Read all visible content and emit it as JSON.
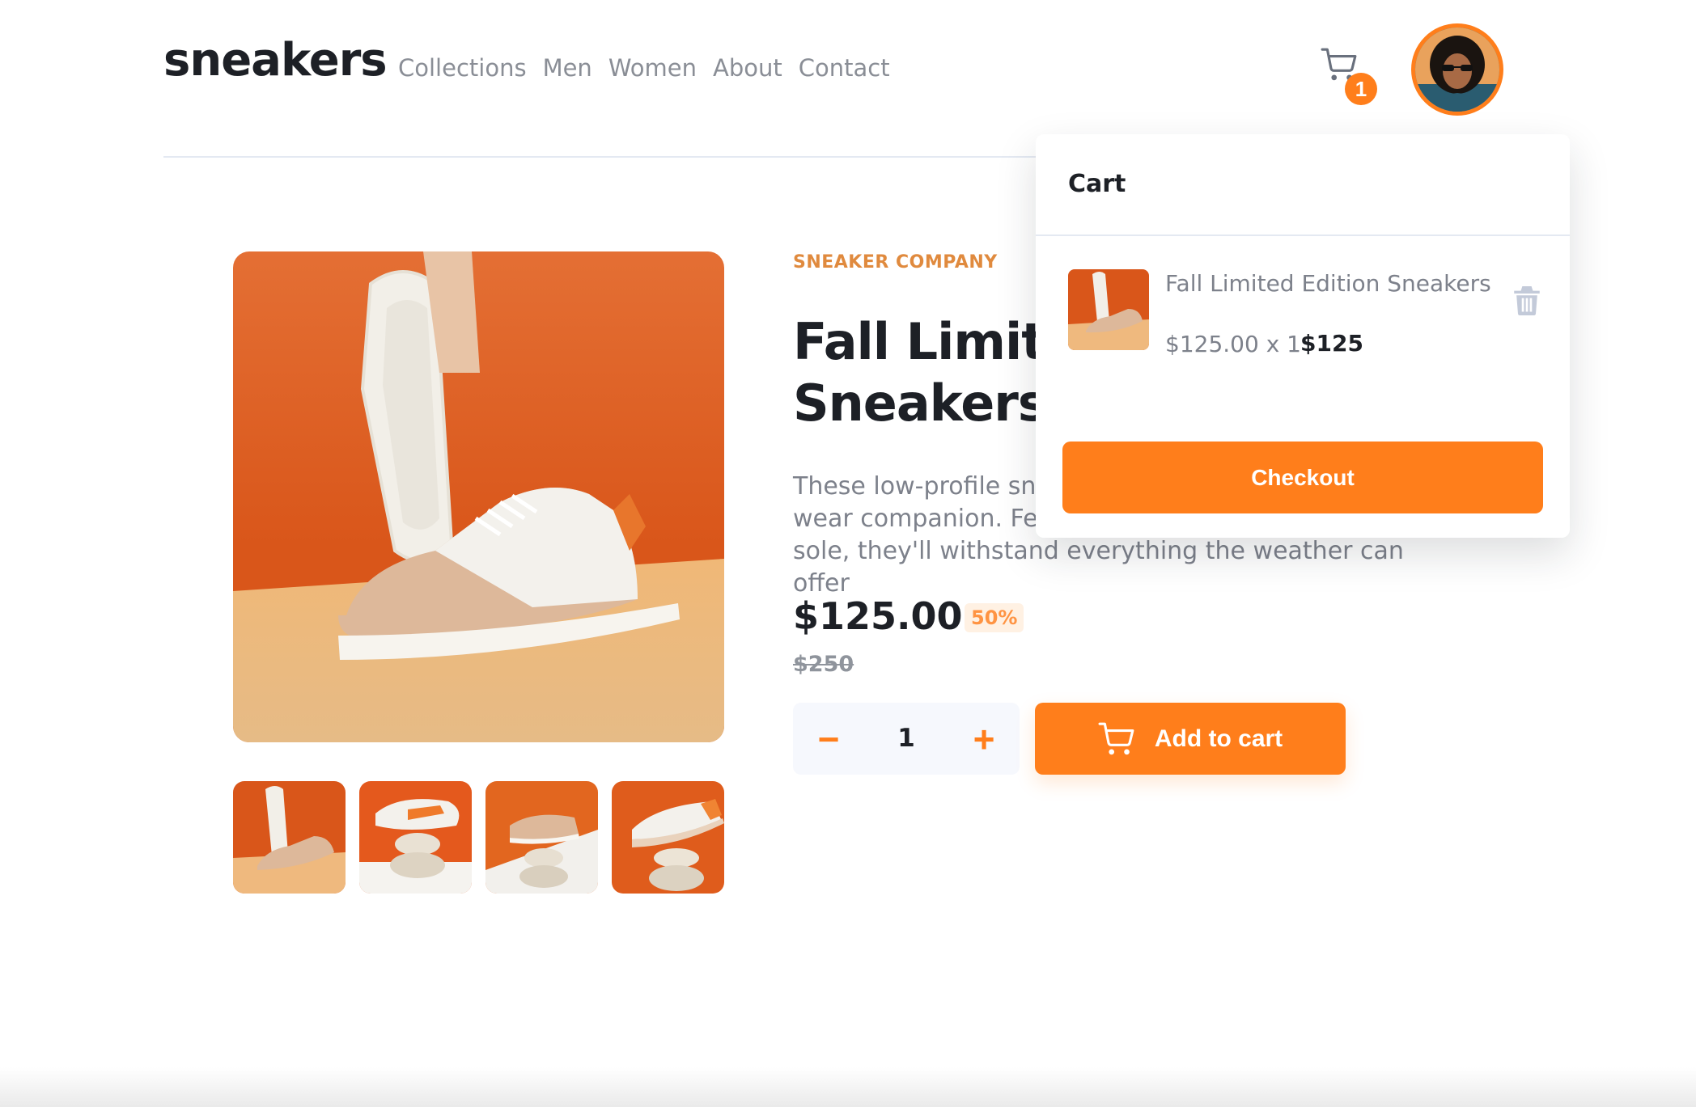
{
  "header": {
    "logo": "sneakers",
    "nav": [
      "Collections",
      "Men",
      "Women",
      "About",
      "Contact"
    ],
    "cart_count": "1",
    "avatar_icon": "user-avatar"
  },
  "product": {
    "company": "SNEAKER COMPANY",
    "title": "Fall Limited Edition Sneakers",
    "description": "These low-profile sneakers are your perfect casual wear companion. Featuring a durable rubber outer sole, they'll withstand everything the weather can offer",
    "price": "$125.00",
    "discount": "50%",
    "old_price": "$250",
    "quantity": "1",
    "minus_label": "−",
    "plus_label": "+",
    "add_to_cart_label": "Add to cart",
    "thumbnails": [
      "thumbnail-1",
      "thumbnail-2",
      "thumbnail-3",
      "thumbnail-4"
    ]
  },
  "cart": {
    "title": "Cart",
    "item": {
      "name": "Fall Limited Edition Sneakers",
      "unit_price_qty": "$125.00 x 1",
      "total": "$125"
    },
    "checkout_label": "Checkout"
  },
  "colors": {
    "accent": "#ff7e1b",
    "accent_light": "#fff1e3",
    "text_dark": "#1d2026",
    "text_gray": "#7d818b"
  }
}
